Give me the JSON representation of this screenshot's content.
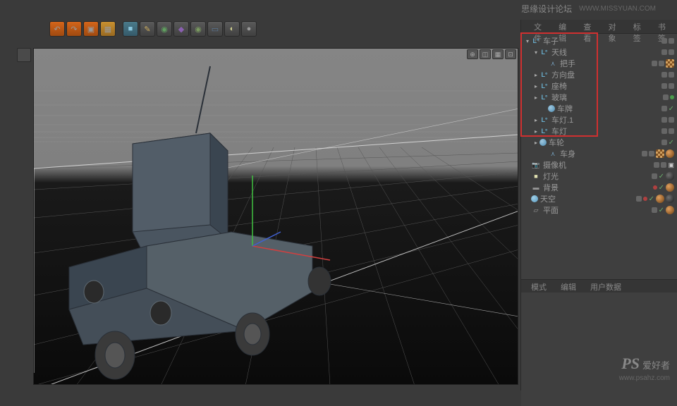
{
  "watermark": {
    "forum": "思缘设计论坛",
    "url1": "WWW.MISSYUAN.COM"
  },
  "toolbar": {
    "undo": "↶",
    "redo": "↷",
    "t3": "▣",
    "t4": "▦",
    "cube": "■",
    "pen": "✎",
    "sub": "◉",
    "def": "◆",
    "env": "◉",
    "cam": "▭",
    "light": "◐",
    "rend": "●"
  },
  "vp_controls": {
    "a": "⊕",
    "b": "◫",
    "c": "▦",
    "d": "⊡"
  },
  "panel": {
    "tabs": {
      "file": "文件",
      "edit": "编辑",
      "view": "查看",
      "obj": "对象",
      "tags": "标签",
      "bookmark": "书签"
    }
  },
  "tree": {
    "car": "车子",
    "antenna": "天线",
    "handle": "把手",
    "wheel_st": "方向盘",
    "seat": "座椅",
    "window": "玻璃",
    "plate": "车牌",
    "light1": "车灯.1",
    "light0": "车灯",
    "wheels": "车轮",
    "body": "车身",
    "camera": "摄像机",
    "lamp": "灯光",
    "bg": "背景",
    "sky": "天空",
    "plane": "平面"
  },
  "attr": {
    "mode": "模式",
    "edit": "编辑",
    "userdata": "用户数据"
  },
  "ps_watermark": {
    "ps": "PS",
    "sub": "爱好者",
    "url": "www.psahz.com"
  }
}
